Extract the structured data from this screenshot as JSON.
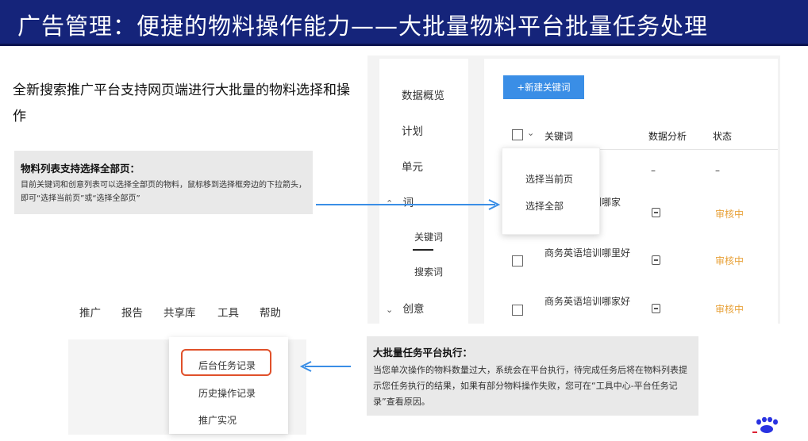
{
  "header": {
    "title": "广告管理：便捷的物料操作能力——大批量物料平台批量任务处理"
  },
  "intro": {
    "text": "全新搜索推广平台支持网页端进行大批量的物料选择和操作"
  },
  "note1": {
    "title": "物料列表支持选择全部页：",
    "body": "目前关键词和创意列表可以选择全部页的物料，鼠标移到选择框旁边的下拉箭头，即可“选择当前页”或“选择全部页”"
  },
  "sidebar": {
    "items": [
      "数据概览",
      "计划",
      "单元",
      "词",
      "关键词",
      "搜索词",
      "创意"
    ]
  },
  "main": {
    "new_button": "+新建关键词",
    "columns": {
      "keyword": "关键词",
      "analysis": "数据分析",
      "status": "状态"
    },
    "rows": [
      {
        "keyword": "",
        "analysis": "–",
        "status": "–"
      },
      {
        "keyword": "商务英语培训哪家",
        "status": "审核中"
      },
      {
        "keyword": "商务英语培训哪里好",
        "status": "审核中"
      },
      {
        "keyword": "商务英语培训哪家好",
        "status": "审核中"
      }
    ],
    "select_menu": [
      "选择当前页",
      "选择全部"
    ]
  },
  "topnav": {
    "items": [
      "推广",
      "报告",
      "共享库",
      "工具",
      "帮助"
    ]
  },
  "tools_menu": {
    "items": [
      "后台任务记录",
      "历史操作记录",
      "推广实况"
    ]
  },
  "note2": {
    "title": "大批量任务平台执行：",
    "body": "当您单次操作的物料数量过大，系统会在平台执行，待完成任务后将在物料列表提示您任务执行的结果，如果有部分物料操作失败，您可在“工具中心-平台任务记录”查看原因。"
  },
  "colors": {
    "header_bg": "#15247a",
    "accent": "#3a8ee6",
    "status": "#e8a23a",
    "highlight": "#e0502a"
  }
}
